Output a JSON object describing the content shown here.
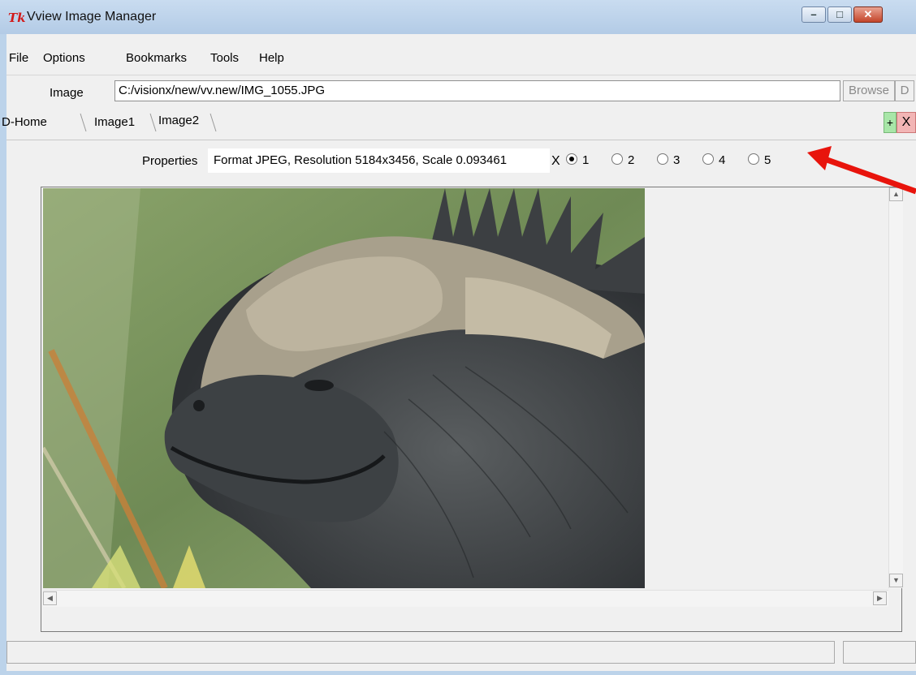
{
  "window": {
    "title": "Vview Image Manager",
    "logo": "Tk",
    "controls": [
      "minimize-icon",
      "maximize-icon",
      "close-icon"
    ]
  },
  "menu": {
    "file": "File",
    "options": "Options",
    "bookmarks": "Bookmarks",
    "tools": "Tools",
    "help": "Help"
  },
  "image_row": {
    "label": "Image",
    "path": "C:/visionx/new/vv.new/IMG_1055.JPG",
    "browse": "Browse",
    "d_button": "D"
  },
  "tabs": [
    {
      "label": "D-Home"
    },
    {
      "label": "Image1"
    },
    {
      "label": "Image2"
    }
  ],
  "tab_actions": {
    "add": "+",
    "close": "X"
  },
  "properties": {
    "label": "Properties",
    "value": "Format JPEG, Resolution 5184x3456, Scale 0.093461",
    "x": "X",
    "options": [
      "1",
      "2",
      "3",
      "4",
      "5"
    ],
    "selected": "1"
  },
  "annotation": {
    "arrow_color": "#e8140c"
  },
  "colors": {
    "window_frame": "#bcd3ea",
    "client": "#f0f0f0",
    "close_button": "#c4452a"
  }
}
